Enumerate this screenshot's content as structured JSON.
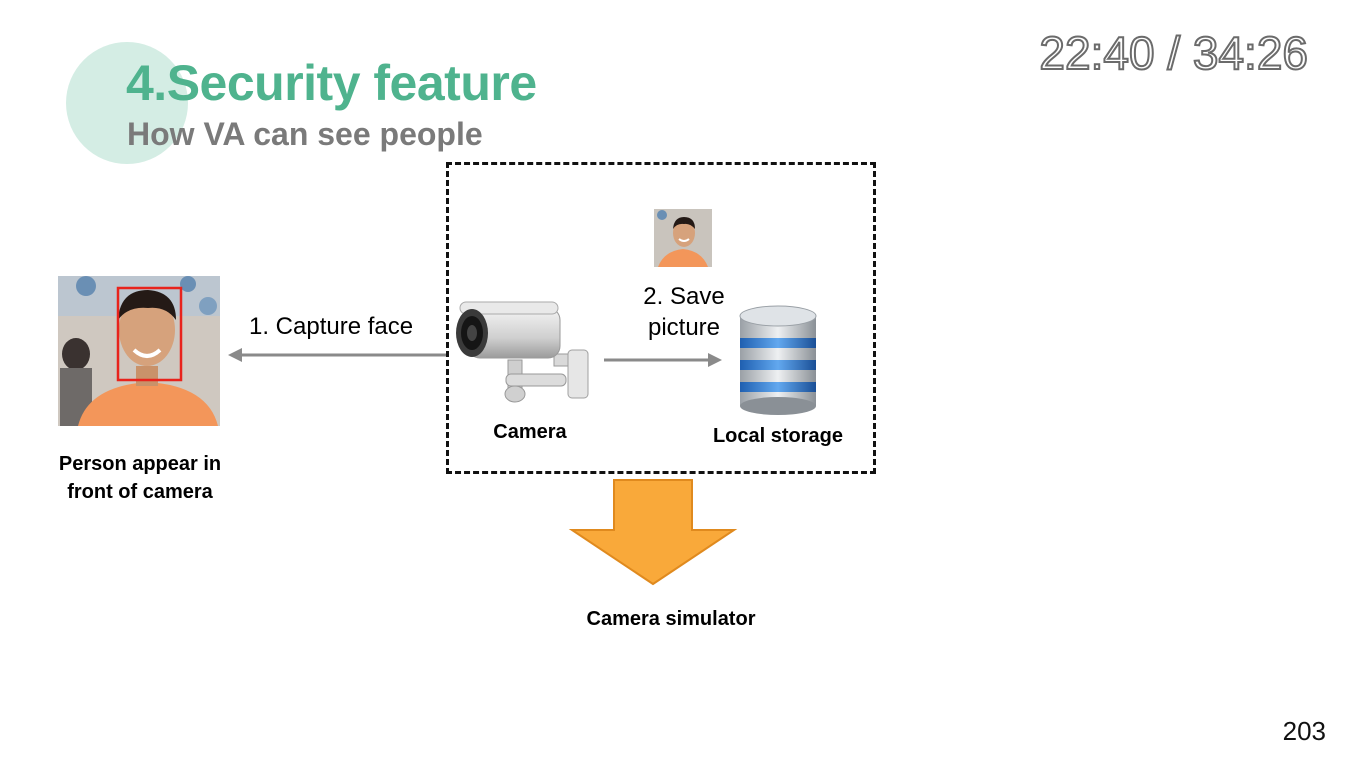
{
  "slide": {
    "title": "4.Security feature",
    "subtitle": "How VA can see people",
    "timer": "22:40 / 34:26",
    "page_number": "203",
    "accent_color": "#4fb38e",
    "arrow_color": "#f9a93a"
  },
  "diagram": {
    "person_label_line1": "Person appear in",
    "person_label_line2": "front of camera",
    "step1_label": "1. Capture face",
    "step2_label_line1": "2. Save",
    "step2_label_line2": "picture",
    "camera_label": "Camera",
    "storage_label": "Local storage",
    "simulator_label": "Camera simulator"
  }
}
